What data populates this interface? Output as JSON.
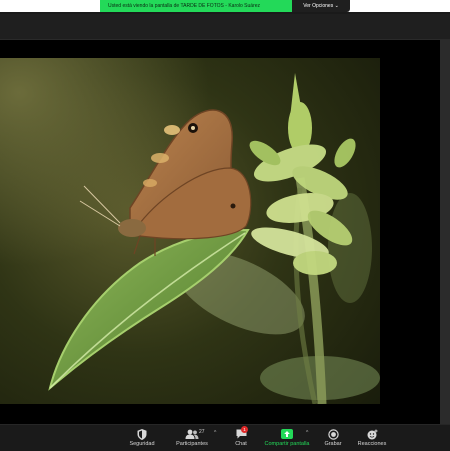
{
  "share_banner": {
    "message": "Usted está viendo la pantalla de TARDE DE FOTOS - Karolo Suárez",
    "view_options_label": "Ver Opciones",
    "view_options_caret": "⌄",
    "banner_color": "#23d959"
  },
  "shared_content": {
    "image_subject": "butterfly on nettle leaf"
  },
  "toolbar": {
    "security_label": "Seguridad",
    "participants_label": "Participantes",
    "participants_count": "27",
    "participants_caret": "^",
    "chat_label": "Chat",
    "chat_badge": "1",
    "share_screen_label": "Compartir pantalla",
    "share_caret": "^",
    "record_label": "Grabar",
    "reactions_label": "Reacciones",
    "accent_color": "#23d959",
    "badge_color": "#e02828"
  }
}
